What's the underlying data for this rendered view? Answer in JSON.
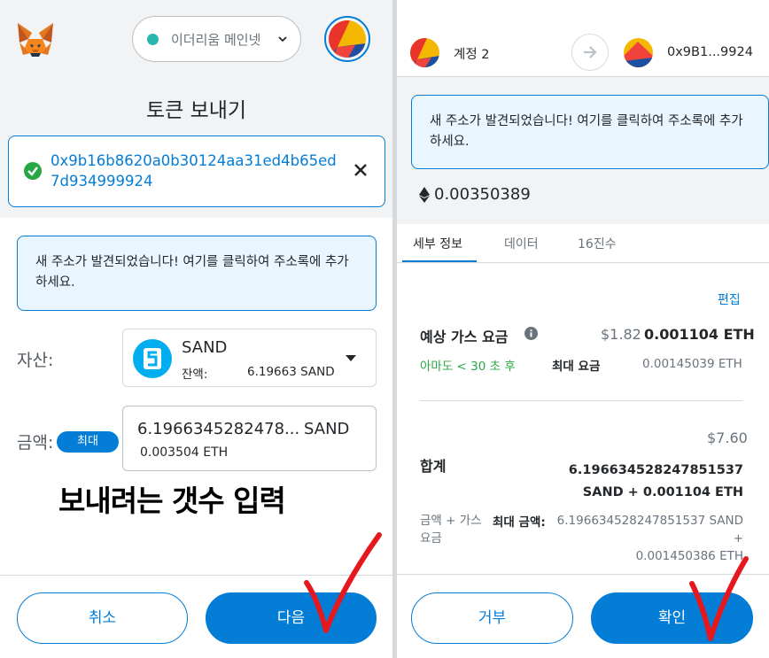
{
  "left": {
    "network": "이더리움 메인넷",
    "page_title": "토큰 보내기",
    "recipient_address": "0x9b16b8620a0b30124aa31ed4b65ed7d934999924",
    "notice": "새 주소가 발견되었습니다! 여기를 클릭하여 주소록에 추가하세요.",
    "asset_label": "자산:",
    "asset_symbol": "SAND",
    "balance_label": "잔액:",
    "balance_value": "6.19663 SAND",
    "amount_label": "금액:",
    "max_label": "최대",
    "amount_value": "6.1966345282478...",
    "amount_unit": "SAND",
    "amount_eth": "0.003504 ETH",
    "annotation": "보내려는 갯수 입력",
    "cancel_label": "취소",
    "next_label": "다음"
  },
  "right": {
    "from_account": "계정 2",
    "to_address": "0x9B1...9924",
    "notice": "새 주소가 발견되었습니다! 여기를 클릭하여 주소록에 추가하세요.",
    "eth_amount": "0.00350389",
    "tabs": [
      "세부 정보",
      "데이터",
      "16진수"
    ],
    "edit_label": "편집",
    "gas_label": "예상 가스 요금",
    "gas_usd": "$1.82",
    "gas_eth": "0.001104 ETH",
    "gas_time": "아마도 < 30 초 후",
    "max_fee_label": "최대 요금",
    "max_fee_value": "0.00145039 ETH",
    "total_usd": "$7.60",
    "total_label": "합계",
    "total_line1": "6.196634528247851537",
    "total_line2": "SAND + 0.001104 ETH",
    "sum_label": "금액 + 가스 요금",
    "sum_max_label": "최대 금액:",
    "sum_max_line1": "6.196634528247851537 SAND +",
    "sum_max_line2": "0.001450386 ETH",
    "reject_label": "거부",
    "confirm_label": "확인"
  },
  "colors": {
    "accent": "#037dd6",
    "notice_bg": "#eaf6ff",
    "network_dot": "#29b6af",
    "success_green": "#28a745",
    "annotation_red": "#e5181e"
  }
}
